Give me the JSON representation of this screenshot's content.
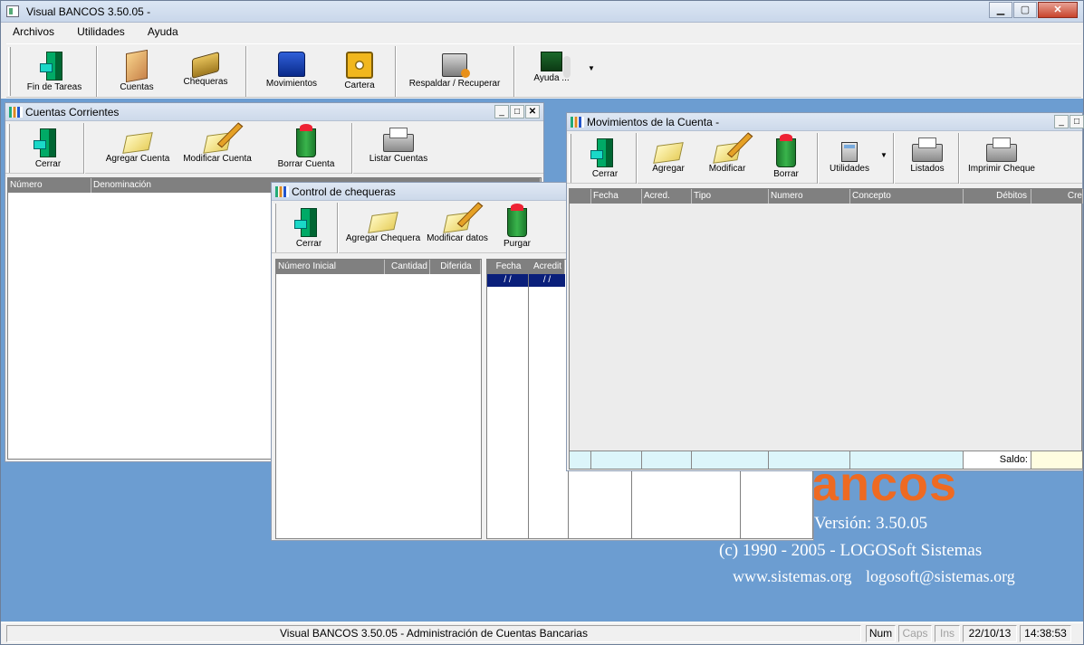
{
  "window": {
    "title": "Visual BANCOS 3.50.05 -",
    "minimize": "▁",
    "maximize": "▢",
    "close": "✕"
  },
  "menu": [
    "Archivos",
    "Utilidades",
    "Ayuda"
  ],
  "toolbar": [
    {
      "label": "Fin de Tareas",
      "icon": "exit-door-icon"
    },
    {
      "label": "Cuentas",
      "icon": "accounts-book-icon"
    },
    {
      "label": "Chequeras",
      "icon": "checkbook-icon"
    },
    {
      "label": "Movimientos",
      "icon": "cash-register-icon"
    },
    {
      "label": "Cartera",
      "icon": "safe-icon"
    },
    {
      "label": "Respaldar / Recuperar",
      "icon": "backup-icon"
    },
    {
      "label": "Ayuda ...",
      "icon": "help-board-icon"
    }
  ],
  "cuentas": {
    "title": "Cuentas Corrientes",
    "buttons": [
      "Cerrar",
      "Agregar Cuenta",
      "Modificar Cuenta",
      "Borrar Cuenta",
      "Listar Cuentas"
    ],
    "columns": [
      "Número",
      "Denominación"
    ]
  },
  "chequeras": {
    "title": "Control de chequeras",
    "buttons": [
      "Cerrar",
      "Agregar Chequera",
      "Modificar datos",
      "Purgar"
    ],
    "columns": [
      "Número Inicial",
      "Cantidad",
      "Diferida"
    ],
    "right_columns": [
      "Fecha",
      "Acredit"
    ],
    "row": [
      "/ /",
      "/ /"
    ]
  },
  "movimientos": {
    "title": "Movimientos de la Cuenta  -",
    "buttons": [
      "Cerrar",
      "Agregar",
      "Modificar",
      "Borrar",
      "Utilidades",
      "Listados",
      "Imprimir Cheque"
    ],
    "columns": [
      "Fecha",
      "Acred.",
      "Tipo",
      "Numero",
      "Concepto",
      "Débitos",
      "Cre"
    ],
    "saldo_label": "Saldo:"
  },
  "splash": {
    "logo": "ancos",
    "version": "Versión: 3.50.05",
    "copyright": "(c) 1990 - 2005 - LOGOSoft Sistemas",
    "web": "www.sistemas.org",
    "email": "logosoft@sistemas.org"
  },
  "status": {
    "text": "Visual BANCOS 3.50.05 - Administración de Cuentas Bancarias",
    "num": "Num",
    "caps": "Caps",
    "ins": "Ins",
    "date": "22/10/13",
    "time": "14:38:53"
  }
}
